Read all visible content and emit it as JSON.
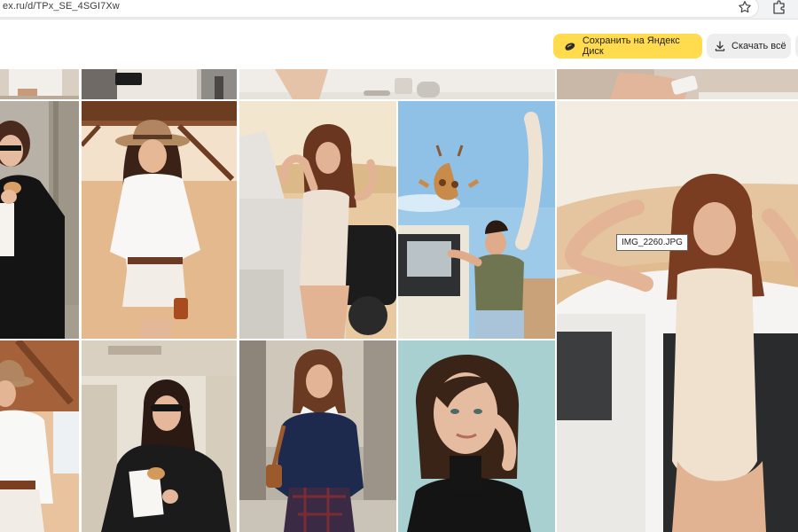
{
  "browser": {
    "url": "ex.ru/d/TPx_SE_4SGI7Xw",
    "bookmark_icon": "star-icon",
    "extensions_icon": "puzzle-icon"
  },
  "toolbar": {
    "save_label": "Сохранить на Яндекс Диск",
    "save_icon": "disk-icon",
    "download_label": "Скачать всё",
    "download_icon": "download-icon"
  },
  "tooltip": {
    "filename": "IMG_2260.JPG"
  },
  "colors": {
    "save_button": "#ffdb4d",
    "download_button": "#eeeeee",
    "address_bar": "#f1f3f4"
  },
  "gallery": {
    "rows": [
      {
        "row": "top-partial",
        "photos": [
          "woman-white-shirt-partial",
          "woman-black-bag-partial",
          "hands-cosmetics-partial",
          "hands-jar-partial"
        ]
      },
      {
        "row": "middle",
        "photos": [
          "woman-black-jacket-croissant",
          "woman-desert-hat-white-shirt",
          "woman-bodysuit-car",
          "woman-giraffe-car",
          "woman-bodysuit-car-large"
        ]
      },
      {
        "row": "bottom",
        "photos": [
          "woman-hat-brown-belt",
          "woman-sunglasses-black-coat",
          "woman-navy-sweater-plaid-skirt",
          "woman-portrait-teal-background"
        ]
      }
    ]
  }
}
